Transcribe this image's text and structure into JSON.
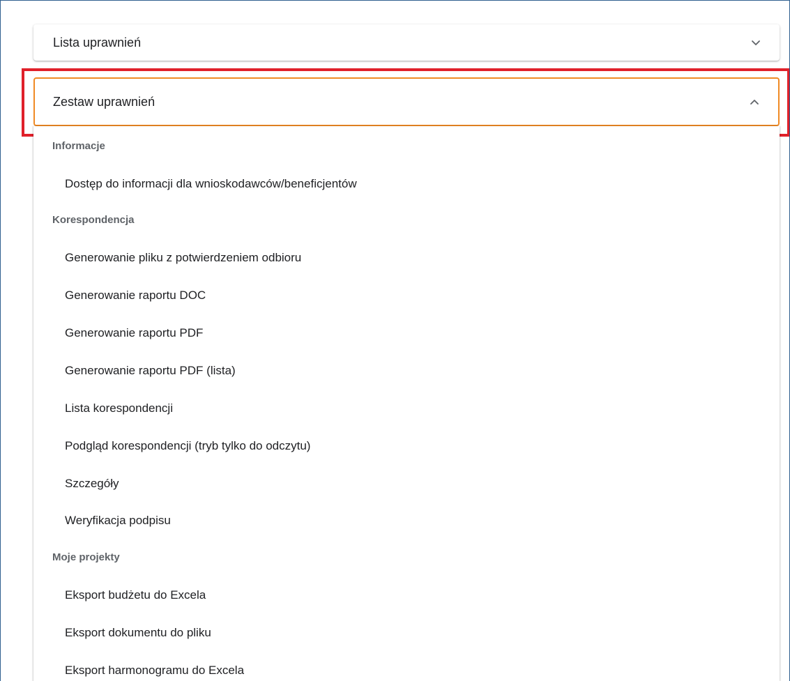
{
  "panels": {
    "permission_list": {
      "title": "Lista uprawnień",
      "state": "collapsed",
      "icon": "chevron-down-icon"
    },
    "permission_set": {
      "title": "Zestaw uprawnień",
      "state": "expanded",
      "icon": "chevron-up-icon",
      "highlight_color": "#e0202a",
      "focus_border_color": "#f08a24"
    }
  },
  "groups": [
    {
      "label": "Informacje",
      "items": [
        "Dostęp do informacji dla wnioskodawców/beneficjentów"
      ]
    },
    {
      "label": "Korespondencja",
      "items": [
        "Generowanie pliku z potwierdzeniem odbioru",
        "Generowanie raportu DOC",
        "Generowanie raportu PDF",
        "Generowanie raportu PDF (lista)",
        "Lista korespondencji",
        "Podgląd korespondencji (tryb tylko do odczytu)",
        "Szczegóły",
        "Weryfikacja podpisu"
      ]
    },
    {
      "label": "Moje projekty",
      "items": [
        "Eksport budżetu do Excela",
        "Eksport dokumentu do pliku",
        "Eksport harmonogramu do Excela"
      ]
    }
  ]
}
